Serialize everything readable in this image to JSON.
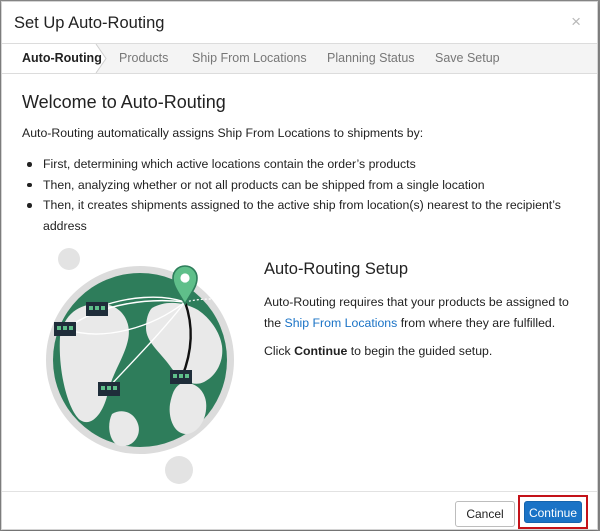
{
  "dialog": {
    "title": "Set Up Auto-Routing",
    "close_symbol": "×"
  },
  "steps": [
    {
      "label": "Auto-Routing",
      "active": true
    },
    {
      "label": "Products",
      "active": false
    },
    {
      "label": "Ship From Locations",
      "active": false
    },
    {
      "label": "Planning Status",
      "active": false
    },
    {
      "label": "Save Setup",
      "active": false
    }
  ],
  "welcome": {
    "heading": "Welcome to Auto-Routing",
    "intro": "Auto-Routing automatically assigns Ship From Locations to shipments by:",
    "bullets": [
      "First, determining which active locations contain the order’s products",
      "Then, analyzing whether or not all products can be shipped from a single location",
      "Then, it creates shipments assigned to the active ship from location(s) nearest to the recipient’s address"
    ]
  },
  "setup": {
    "title": "Auto-Routing Setup",
    "body_prefix": "Auto-Routing requires that your products be assigned to the ",
    "link": "Ship From Locations",
    "body_suffix": " from where they are fulfilled.",
    "click_prefix": "Click ",
    "click_bold": "Continue",
    "click_suffix": " to begin the guided setup."
  },
  "footer": {
    "cancel_label": "Cancel",
    "continue_label": "Continue"
  },
  "colors": {
    "accent": "#1a73c6",
    "globe_green": "#2e7d5b",
    "highlight_border": "#c41219"
  },
  "icons": {
    "close": "close-icon",
    "illustration": "globe-illustration",
    "pin": "location-pin-icon",
    "warehouse": "warehouse-icon"
  }
}
